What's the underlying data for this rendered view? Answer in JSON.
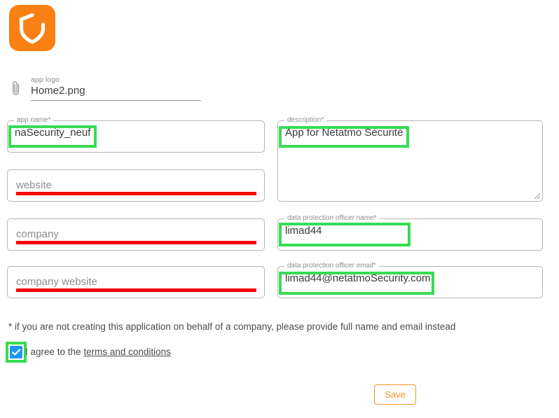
{
  "brand": {
    "logo_icon": "shield-icon",
    "logo_bg_color": "#F98012",
    "logo_shape_color": "#FFFFFF"
  },
  "annotation": {
    "green_color": "#37DC52",
    "red_color": "#F40000"
  },
  "file_upload": {
    "icon": "paperclip-icon",
    "label": "app logo",
    "value": "Home2.png"
  },
  "form": {
    "app_name": {
      "label": "app name*",
      "value": "naSecurity_neuf"
    },
    "description": {
      "label": "description*",
      "value": "App for Netatmo Sécurité"
    },
    "website": {
      "label": "",
      "placeholder": "website",
      "value": ""
    },
    "company": {
      "label": "",
      "placeholder": "company",
      "value": ""
    },
    "company_website": {
      "label": "",
      "placeholder": "company website",
      "value": ""
    },
    "dpo_name": {
      "label": "data protection officer name*",
      "value": "limad44"
    },
    "dpo_email": {
      "label": "data protection officer email*",
      "value": "limad44@netatmoSecurity.com"
    }
  },
  "note": "* if you are not creating this application on behalf of a company, please provide full name and email instead",
  "agree": {
    "checked": true,
    "text_before": "I agree to the ",
    "link_text": "terms and conditions"
  },
  "actions": {
    "save_label": "Save"
  }
}
